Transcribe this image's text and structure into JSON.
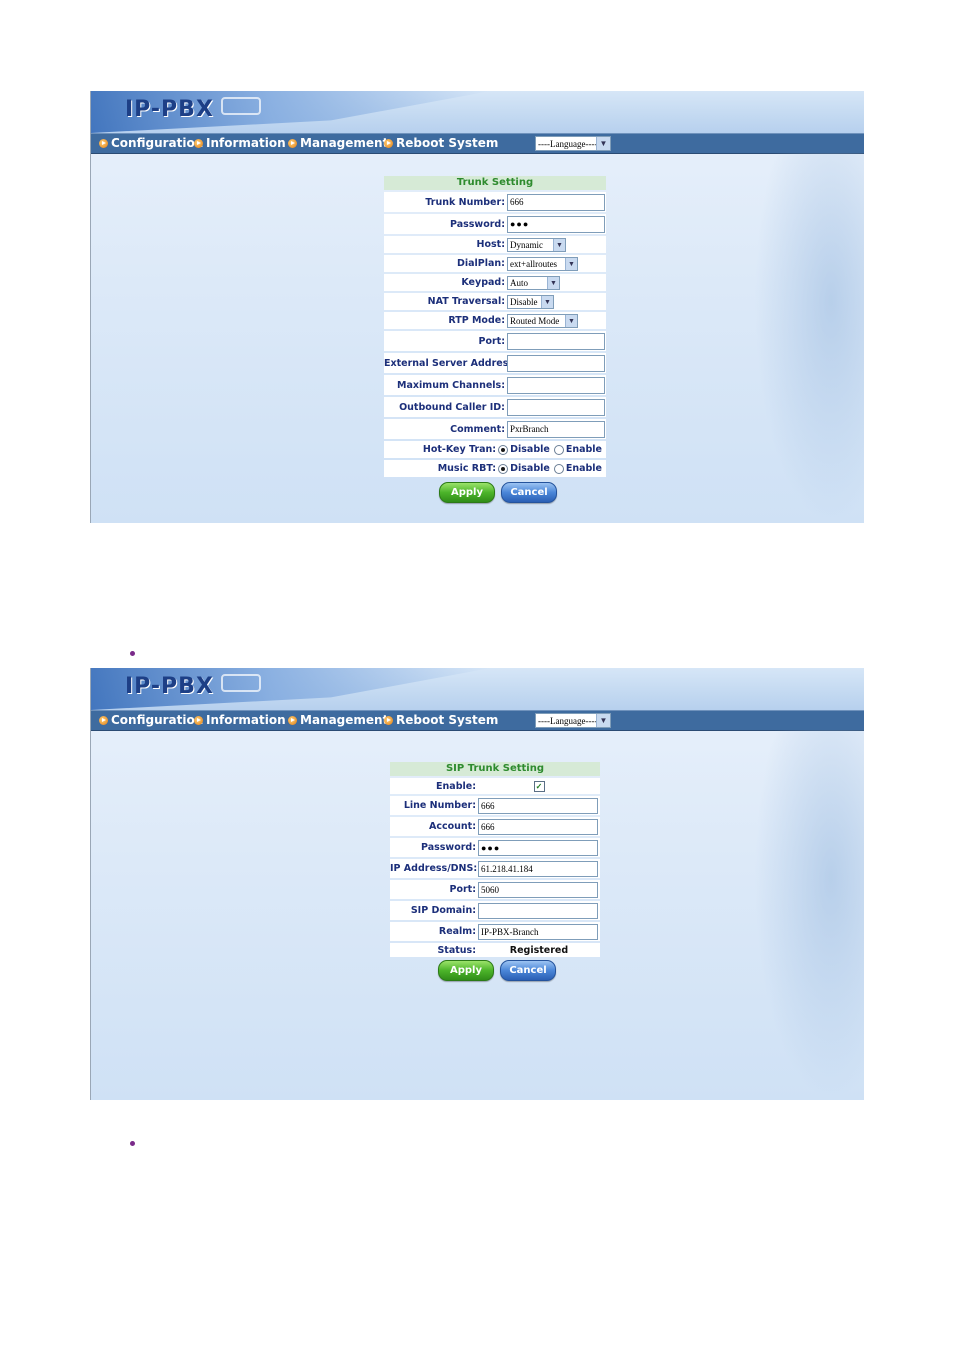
{
  "screens": [
    {
      "logo": "IP-PBX",
      "nav": [
        "Configuration",
        "Information",
        "Management",
        "Reboot System"
      ],
      "language": "----Language----",
      "form_title": "Trunk Setting",
      "fields": {
        "trunk_number": {
          "label": "Trunk Number:",
          "value": "666"
        },
        "password": {
          "label": "Password:",
          "value": "●●●"
        },
        "host": {
          "label": "Host:",
          "value": "Dynamic"
        },
        "dialplan": {
          "label": "DialPlan:",
          "value": "ext+allroutes"
        },
        "keypad": {
          "label": "Keypad:",
          "value": "Auto"
        },
        "nat": {
          "label": "NAT Traversal:",
          "value": "Disable"
        },
        "rtp": {
          "label": "RTP Mode:",
          "value": "Routed Mode"
        },
        "port": {
          "label": "Port:",
          "value": ""
        },
        "ext_server": {
          "label": "External Server Address:",
          "value": ""
        },
        "max_channels": {
          "label": "Maximum Channels:",
          "value": ""
        },
        "outbound_cid": {
          "label": "Outbound Caller ID:",
          "value": ""
        },
        "comment": {
          "label": "Comment:",
          "value": "PxrBranch"
        },
        "hotkey": {
          "label": "Hot-Key Tran:",
          "opt1": "Disable",
          "opt2": "Enable"
        },
        "music_rbt": {
          "label": "Music RBT:",
          "opt1": "Disable",
          "opt2": "Enable"
        }
      },
      "apply": "Apply",
      "cancel": "Cancel"
    },
    {
      "logo": "IP-PBX",
      "nav": [
        "Configuration",
        "Information",
        "Management",
        "Reboot System"
      ],
      "language": "----Language----",
      "form_title": "SIP Trunk Setting",
      "fields": {
        "enable": {
          "label": "Enable:",
          "checked": true
        },
        "line_number": {
          "label": "Line Number:",
          "value": "666"
        },
        "account": {
          "label": "Account:",
          "value": "666"
        },
        "password": {
          "label": "Password:",
          "value": "●●●"
        },
        "ip": {
          "label": "IP Address/DNS:",
          "value": "61.218.41.184"
        },
        "port": {
          "label": "Port:",
          "value": "5060"
        },
        "sip_domain": {
          "label": "SIP Domain:",
          "value": ""
        },
        "realm": {
          "label": "Realm:",
          "value": "IP-PBX-Branch"
        },
        "status": {
          "label": "Status:",
          "value": "Registered"
        }
      },
      "apply": "Apply",
      "cancel": "Cancel"
    }
  ],
  "icons": {
    "nav_bullet": "orange-arrow-bullet-icon",
    "select_arrow": "chevron-down-icon",
    "check": "checkmark-icon"
  }
}
